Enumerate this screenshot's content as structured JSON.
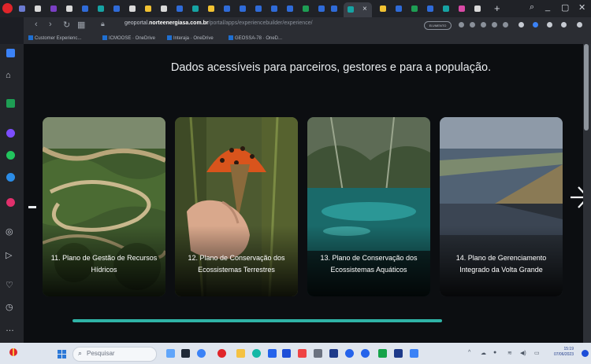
{
  "browser": {
    "url_prefix": "geoportal.",
    "url_domain": "norteenergiasa.com.br",
    "url_path": "/portal/apps/experiencebuilder/experience/",
    "pill_label": "ELVMENTO",
    "new_tab_symbol": "+",
    "active_tab_close": "×",
    "window_minimize": "_",
    "window_maximize": "▢",
    "window_close": "✕",
    "bookmarks": [
      {
        "label": "Customer Experienc..."
      },
      {
        "label": "ICMOOSE · OneDrive"
      },
      {
        "label": "Interaja · OneDrive"
      },
      {
        "label": "GEOSSA-78 · OneD..."
      }
    ]
  },
  "page": {
    "headline": "Dados acessíveis para parceiros, gestores e para a população.",
    "cards": [
      {
        "title": "11. Plano de Gestão de Recursos Hídricos"
      },
      {
        "title": "12. Plano de Conservação dos Ecossistemas Terrestres"
      },
      {
        "title": "13. Plano de Conservação dos Ecossistemas Aquáticos"
      },
      {
        "title": "14. Plano de Gerenciamento Integrado da Volta Grande"
      }
    ],
    "next_arrow_icon": "arrow-right-icon",
    "carousel_progress": 0.72
  },
  "taskbar": {
    "search_placeholder": "Pesquisar",
    "clock_time": "15:19",
    "clock_date": "07/06/2023"
  },
  "colors": {
    "accent_teal": "#2fb3a6",
    "browser_red": "#e0252a",
    "page_background": "#0c0e11"
  }
}
